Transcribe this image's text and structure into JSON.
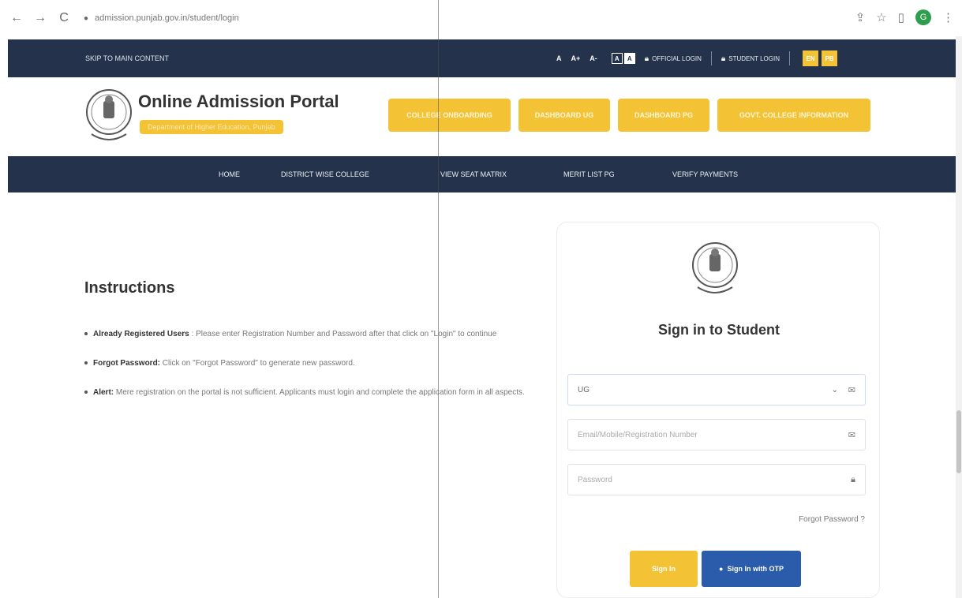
{
  "browser": {
    "url": "admission.punjab.gov.in/student/login",
    "back": "←",
    "forward": "→",
    "reload": "C",
    "profile_initial": "G"
  },
  "topbar": {
    "skip": "SKIP TO MAIN CONTENT",
    "font_small": "A",
    "font_plus": "A+",
    "font_minus": "A-",
    "contrast_dark": "A",
    "contrast_light": "A",
    "official_login": "OFFICIAL LOGIN",
    "student_login": "STUDENT LOGIN",
    "lang_en": "EN",
    "lang_pb": "PB"
  },
  "header": {
    "title": "Online Admission Portal",
    "subtitle": "Department of Higher Education, Punjab",
    "buttons": [
      "COLLEGE ONBOARDING",
      "DASHBOARD UG",
      "DASHBOARD PG",
      "GOVT. COLLEGE INFORMATION"
    ]
  },
  "nav": [
    "HOME",
    "DISTRICT WISE COLLEGE",
    "VIEW SEAT MATRIX",
    "MERIT LIST PG",
    "VERIFY PAYMENTS"
  ],
  "instructions": {
    "title": "Instructions",
    "items": [
      {
        "label": "Already Registered Users",
        "text": " : Please enter Registration Number and Password after that click on \"Login\" to continue"
      },
      {
        "label": "Forgot Password:",
        "text": " Click on \"Forgot Password\" to generate new password."
      },
      {
        "label": "Alert:",
        "text": " Mere registration on the portal is not sufficient. Applicants must login and complete the application form in all aspects."
      }
    ]
  },
  "signin": {
    "title": "Sign in to Student",
    "level_value": "UG",
    "user_placeholder": "Email/Mobile/Registration Number",
    "password_placeholder": "Password",
    "forgot": "Forgot Password ?",
    "signin_button": "Sign In",
    "otp_button": "Sign In with OTP"
  },
  "colors": {
    "navy": "#24324b",
    "accent": "#f4c235",
    "otp_blue": "#2a5cab"
  }
}
